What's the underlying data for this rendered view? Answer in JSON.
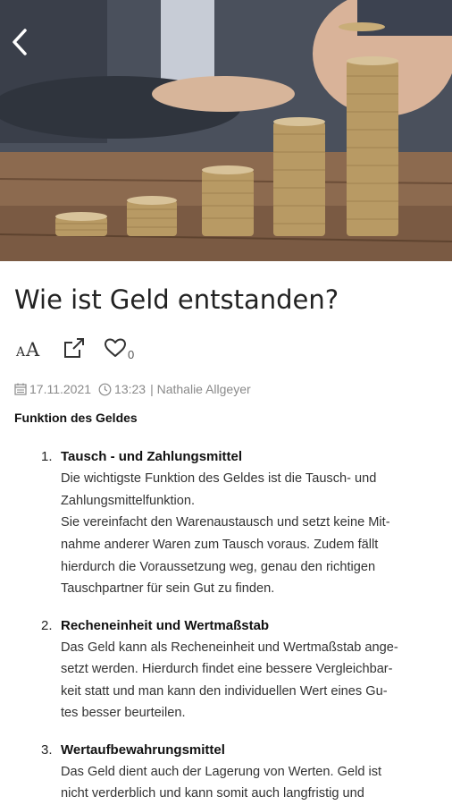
{
  "article": {
    "title": "Wie ist Geld entstanden?",
    "likes": "0",
    "date": "17.11.2021",
    "time": "13:23",
    "author_sep": "| Nathalie Allgeyer",
    "section_heading": "Funktion des Geldes"
  },
  "list": [
    {
      "number": "1.",
      "heading": "Tausch -  und Zahlungsmittel",
      "lines": [
        "Die wichtigste Funktion des Geldes ist die Tausch- und",
        "Zahlungsmittelfunktion.",
        "Sie vereinfacht den Warenaustausch und setzt keine Mit-",
        "nahme anderer Waren zum Tausch voraus. Zudem fällt",
        "hierdurch die Voraussetzung weg, genau den richtigen",
        "Tauschpartner für sein Gut zu finden."
      ]
    },
    {
      "number": "2.",
      "heading": "Recheneinheit und Wertmaßstab",
      "lines": [
        "Das Geld kann als Recheneinheit und Wertmaßstab ange-",
        "setzt werden. Hierdurch findet eine bessere Vergleichbar-",
        "keit statt und man kann den individuellen Wert eines Gu-",
        "tes besser beurteilen."
      ]
    },
    {
      "number": "3.",
      "heading": "Wertaufbewahrungsmittel",
      "lines": [
        "Das Geld dient auch der Lagerung von Werten. Geld ist",
        "nicht verderblich und kann somit auch langfristig und"
      ]
    }
  ],
  "icons": {
    "back": "chevron-left-icon",
    "font_size": "font-size-icon",
    "share": "share-icon",
    "like": "heart-icon",
    "calendar": "calendar-icon",
    "clock": "clock-icon"
  },
  "colors": {
    "meta_text": "#8a8a8a",
    "title_text": "#222222"
  }
}
